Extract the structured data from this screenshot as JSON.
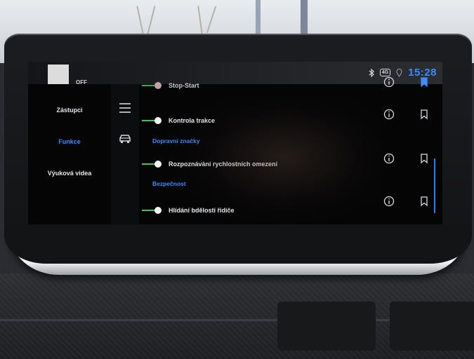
{
  "status": {
    "off_label": "OFF",
    "time": "15:28",
    "network": "4G"
  },
  "sidebar": {
    "items": [
      {
        "label": "Zástupci",
        "active": false
      },
      {
        "label": "Funkce",
        "active": true
      },
      {
        "label": "Výuková videa",
        "active": false
      }
    ]
  },
  "list": {
    "row0": "Stop-Start",
    "row1": "Kontrola trakce",
    "section1": "Dopravní značky",
    "row2": "Rozpoznávání rychlostních omezení",
    "section2": "Bezpečnost",
    "row3": "Hlídání bdělosti řidiče"
  },
  "colors": {
    "accent": "#3f8cff",
    "toggle_on": "#35c85a",
    "clock": "#3a8cff"
  },
  "icons": [
    "bluetooth-icon",
    "network-4g-icon",
    "location-icon",
    "menu-icon",
    "car-icon",
    "info-icon",
    "bookmark-icon"
  ]
}
